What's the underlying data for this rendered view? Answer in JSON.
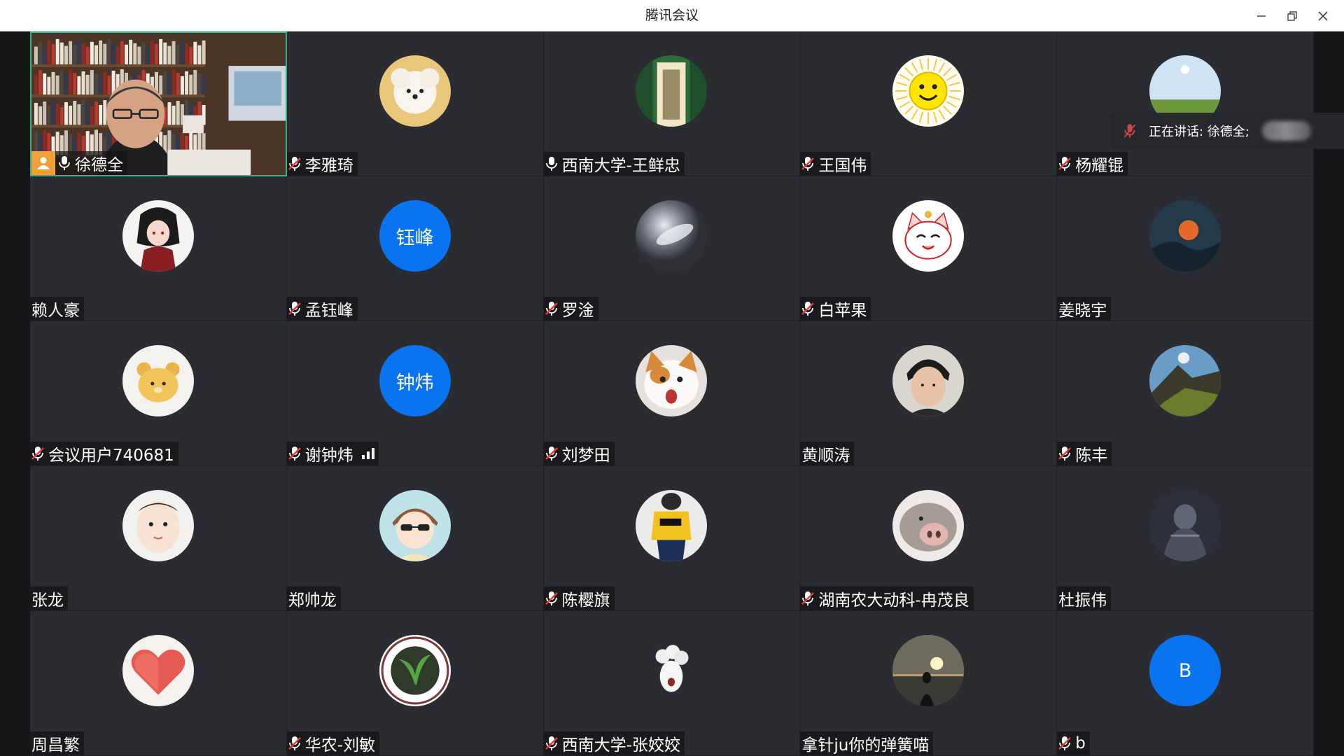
{
  "window": {
    "title": "腾讯会议"
  },
  "speaking": {
    "label": "正在讲话: 徐德全;"
  },
  "participants": [
    {
      "name": "徐德全",
      "mic": "on",
      "host": true,
      "avatar": "video-feed"
    },
    {
      "name": "李雅琦",
      "mic": "muted",
      "avatar": "white-puppy"
    },
    {
      "name": "西南大学-王鲜忠",
      "mic": "on",
      "avatar": "green-corridor"
    },
    {
      "name": "王国伟",
      "mic": "muted",
      "avatar": "smiley-sun"
    },
    {
      "name": "杨耀锟",
      "mic": "muted",
      "avatar": "sky-landscape"
    },
    {
      "name": "赖人豪",
      "mic": "none",
      "avatar": "anime-character"
    },
    {
      "name": "孟钰峰",
      "mic": "muted",
      "avatar_text": "钰峰"
    },
    {
      "name": "罗淦",
      "mic": "muted",
      "avatar": "glass-orb"
    },
    {
      "name": "白苹果",
      "mic": "muted",
      "avatar": "lucky-cat"
    },
    {
      "name": "姜晓宇",
      "mic": "none",
      "avatar": "dark-landscape"
    },
    {
      "name": "会议用户740681",
      "mic": "muted",
      "avatar": "yellow-bear"
    },
    {
      "name": "谢钟炜",
      "mic": "muted",
      "avatar_text": "钟炜",
      "signal": true
    },
    {
      "name": "刘梦田",
      "mic": "muted",
      "avatar": "cat-face"
    },
    {
      "name": "黄顺涛",
      "mic": "none",
      "avatar": "boy-photo"
    },
    {
      "name": "陈丰",
      "mic": "muted",
      "avatar": "mountain"
    },
    {
      "name": "张龙",
      "mic": "none",
      "avatar": "baby-photo"
    },
    {
      "name": "郑帅龙",
      "mic": "none",
      "avatar": "cartoon-boy"
    },
    {
      "name": "陈樱旗",
      "mic": "muted",
      "avatar": "yellow-shirt"
    },
    {
      "name": "湖南农大动科-冉茂良",
      "mic": "muted",
      "avatar": "pig-nose"
    },
    {
      "name": "杜振伟",
      "mic": "none",
      "avatar": "dark-figure"
    },
    {
      "name": "周昌繁",
      "mic": "none",
      "avatar": "red-heart"
    },
    {
      "name": "华农-刘敏",
      "mic": "muted",
      "avatar": "plant-badge"
    },
    {
      "name": "西南大学-张姣姣",
      "mic": "muted",
      "avatar": "white-mask"
    },
    {
      "name": "拿针ju你的弹簧喵",
      "mic": "none",
      "avatar": "sunset-silhouette"
    },
    {
      "name": "b",
      "mic": "muted",
      "avatar_text": "B"
    }
  ]
}
